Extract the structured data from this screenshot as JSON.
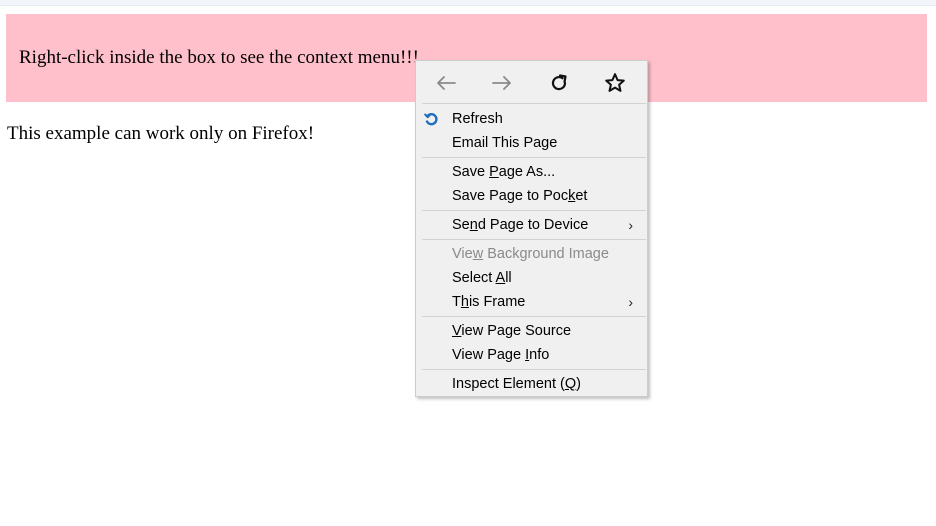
{
  "page": {
    "box_text": "Right-click inside the box to see the context menu!!!",
    "body_text": "This example can work only on Firefox!"
  },
  "colors": {
    "box_background": "#ffc0cb",
    "menu_background": "#f0f0f0",
    "disabled_text": "#8a8a8a",
    "refresh_icon": "#1f6fbf"
  },
  "context_menu": {
    "nav": {
      "back_icon": "arrow-left-icon",
      "forward_icon": "arrow-right-icon",
      "reload_icon": "reload-icon",
      "bookmark_icon": "star-icon"
    },
    "items": [
      {
        "pre": "Refresh",
        "u": "",
        "post": "",
        "icon": "refresh-icon"
      },
      {
        "pre": "Email This Page",
        "u": "",
        "post": ""
      },
      {
        "pre": "Save ",
        "u": "P",
        "post": "age As..."
      },
      {
        "pre": "Save Page to Poc",
        "u": "k",
        "post": "et"
      },
      {
        "pre": "Se",
        "u": "n",
        "post": "d Page to Device",
        "submenu_arrow": "›"
      },
      {
        "pre": "Vie",
        "u": "w",
        "post": " Background Image",
        "disabled": true
      },
      {
        "pre": "Select ",
        "u": "A",
        "post": "ll"
      },
      {
        "pre": "T",
        "u": "h",
        "post": "is Frame",
        "submenu_arrow": "›"
      },
      {
        "pre": "",
        "u": "V",
        "post": "iew Page Source"
      },
      {
        "pre": "View Page ",
        "u": "I",
        "post": "nfo"
      },
      {
        "pre": "Inspect Element (",
        "u": "Q",
        "post": ")"
      }
    ]
  }
}
